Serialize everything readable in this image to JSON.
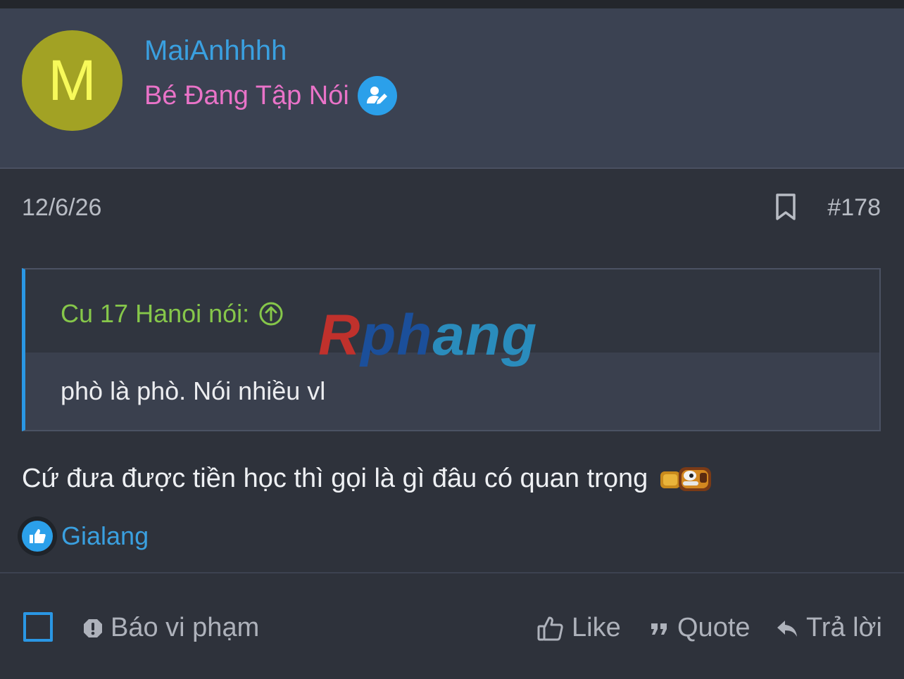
{
  "user": {
    "avatar_letter": "M",
    "name": "MaiAnhhhh",
    "title": "Bé Đang Tập Nói"
  },
  "post": {
    "date": "12/6/26",
    "number": "#178",
    "quote": {
      "author": "Cu 17 Hanoi nói:",
      "text": "phò là phò. Nói nhiều vl"
    },
    "message": "Cứ đưa được tiền học thì gọi là gì đâu có quan trọng",
    "reaction_user": "Gialang"
  },
  "watermark": {
    "part1": "R",
    "part2": "ph",
    "part3": "ang"
  },
  "actions": {
    "report": "Báo vi phạm",
    "like": "Like",
    "quote": "Quote",
    "reply": "Trả lời"
  },
  "colors": {
    "accent": "#2a97e4",
    "username": "#3aa0e0",
    "usertitle": "#e973c8",
    "quote_author": "#86c74a",
    "avatar_bg": "#a2a224"
  }
}
